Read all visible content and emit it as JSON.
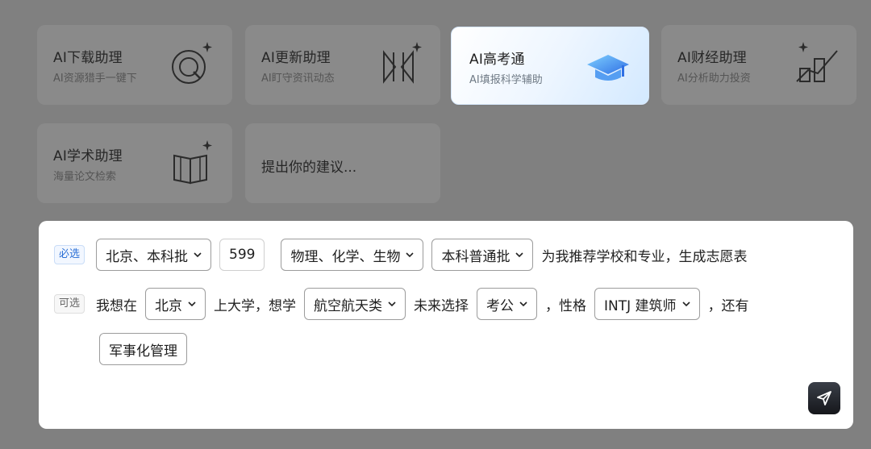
{
  "cards": [
    {
      "title": "AI下载助理",
      "sub": "AI资源猎手一键下",
      "icon": "magnify-target-icon"
    },
    {
      "title": "AI更新助理",
      "sub": "AI盯守资讯动态",
      "icon": "watch-update-icon"
    },
    {
      "title": "AI高考通",
      "sub": "AI填报科学辅助",
      "icon": "graduation-cap-icon"
    },
    {
      "title": "AI财经助理",
      "sub": "AI分析助力投资",
      "icon": "finance-chart-icon"
    },
    {
      "title": "AI学术助理",
      "sub": "海量论文检索",
      "icon": "open-book-icon"
    }
  ],
  "suggest": {
    "label": "提出你的建议..."
  },
  "form": {
    "required_tag": "必选",
    "optional_tag": "可选",
    "region": "北京、本科批",
    "score": "599",
    "subjects": "物理、化学、生物",
    "batch": "本科普通批",
    "required_suffix": "为我推荐学校和专业，生成志愿表",
    "text_study_in": "我想在",
    "city": "北京",
    "text_college_major": "上大学，想学",
    "major": "航空航天类",
    "text_future": "未来选择",
    "career": "考公",
    "text_personality": "，性格",
    "personality": "INTJ 建筑师",
    "text_also": "，还有",
    "extra": "军事化管理"
  },
  "colors": {
    "overlay": "#808080",
    "accent_blue": "#2a6fd6",
    "send_button": "#1f2227"
  }
}
